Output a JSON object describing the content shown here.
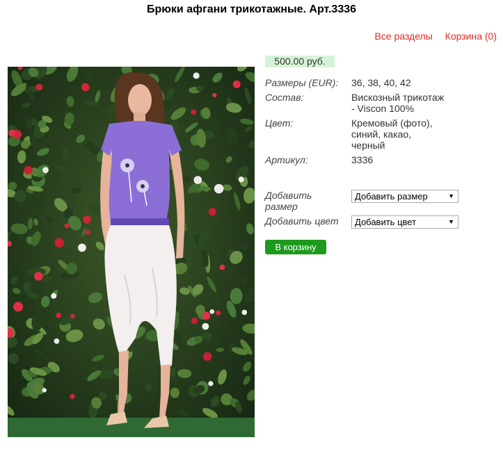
{
  "page": {
    "title": "Брюки афгани трикотажные. Арт.3336"
  },
  "nav": {
    "all_sections": "Все разделы",
    "cart": "Корзина (0)"
  },
  "product": {
    "image_alt": "Брюки афгани трикотажные",
    "price": "500.00 руб.",
    "props": [
      {
        "label": "Размеры (EUR):",
        "value": "36, 38, 40, 42"
      },
      {
        "label": "Состав:",
        "value": "Вискозный трикотаж - Viscon 100%"
      },
      {
        "label": "Цвет:",
        "value": "Кремовый (фото), синий, какао, черный"
      },
      {
        "label": "Артикул:",
        "value": "3336"
      }
    ],
    "add_size": {
      "label": "Добавить размер",
      "selected": "Добавить размер"
    },
    "add_color": {
      "label": "Добавить цвет",
      "selected": "Добавить цвет"
    },
    "buy_button": "В корзину"
  },
  "colors": {
    "link": "#e02b20",
    "price_bg": "#d7f3d7",
    "button": "#1b9a1b"
  }
}
